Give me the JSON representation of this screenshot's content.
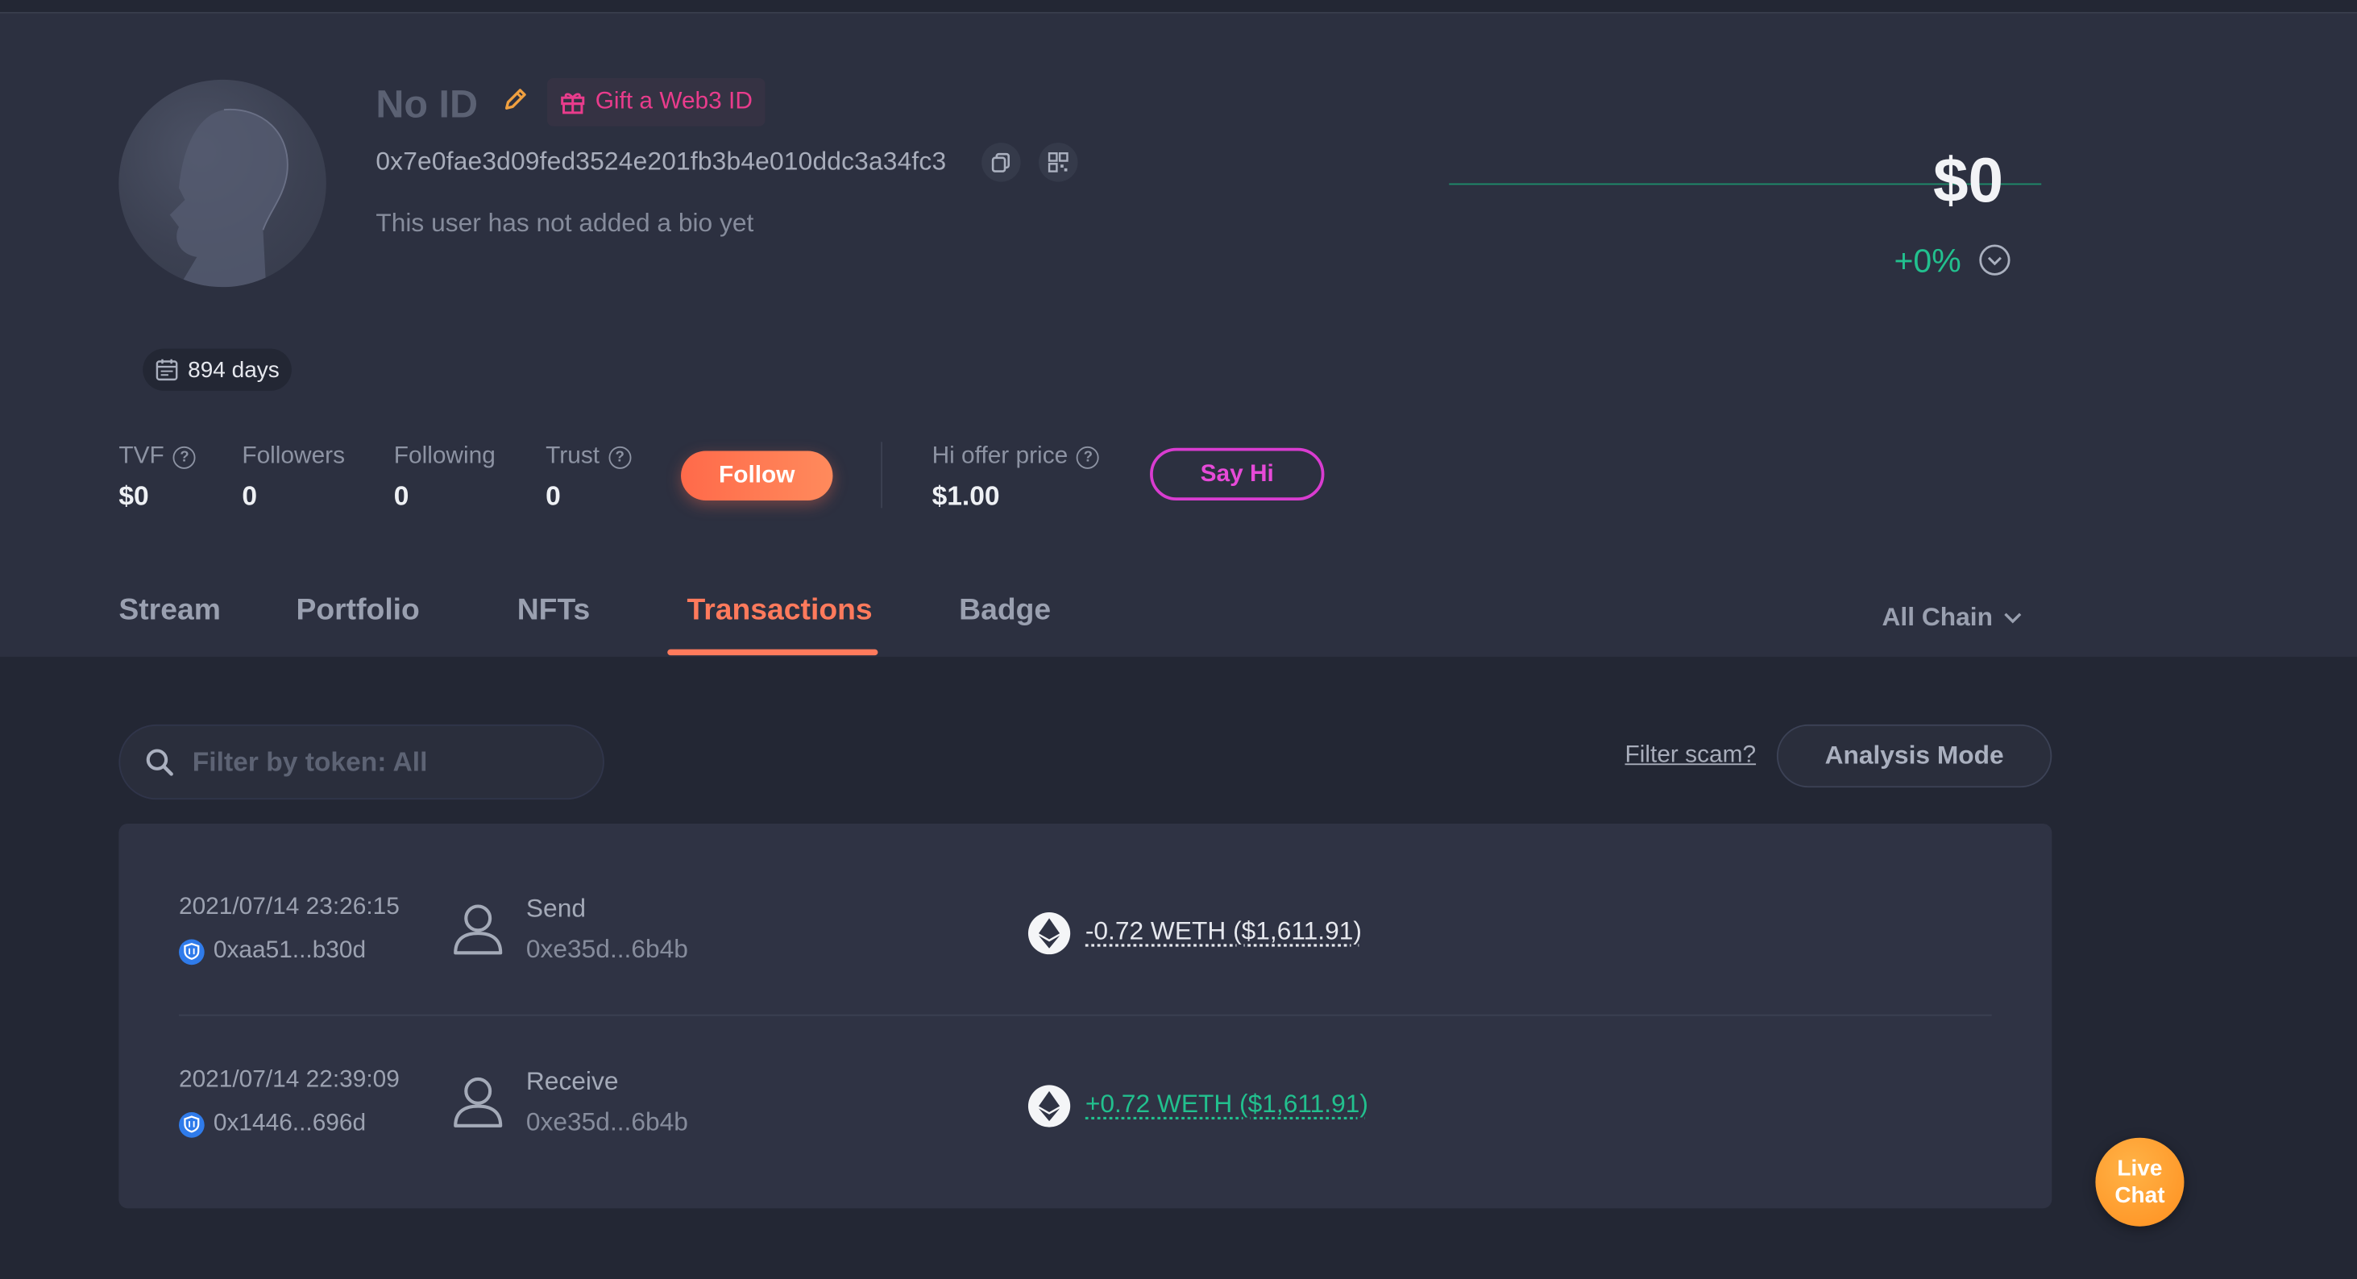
{
  "profile": {
    "name": "No ID",
    "gift_label": "Gift a Web3 ID",
    "address": "0x7e0fae3d09fed3524e201fb3b4e010ddc3a34fc3",
    "bio": "This user has not added a bio yet",
    "days": "894 days"
  },
  "net_worth": {
    "value": "$0",
    "change": "+0%"
  },
  "stats": {
    "tvf": {
      "label": "TVF",
      "value": "$0"
    },
    "followers": {
      "label": "Followers",
      "value": "0"
    },
    "following": {
      "label": "Following",
      "value": "0"
    },
    "trust": {
      "label": "Trust",
      "value": "0"
    },
    "follow_label": "Follow",
    "hi_offer": {
      "label": "Hi offer price",
      "value": "$1.00"
    },
    "say_hi_label": "Say Hi"
  },
  "tabs": [
    {
      "label": "Stream"
    },
    {
      "label": "Portfolio"
    },
    {
      "label": "NFTs"
    },
    {
      "label": "Transactions",
      "active": true
    },
    {
      "label": "Badge"
    }
  ],
  "chain_filter": "All Chain",
  "toolbar": {
    "search_placeholder": "Filter by token: All",
    "filter_scam": "Filter scam?",
    "analysis_mode": "Analysis Mode"
  },
  "transactions": [
    {
      "time": "2021/07/14 23:26:15",
      "from": "0xaa51...b30d",
      "type": "Send",
      "counterparty": "0xe35d...6b4b",
      "amount": "-0.72 WETH ($1,611.91)"
    },
    {
      "time": "2021/07/14 22:39:09",
      "from": "0x1446...696d",
      "type": "Receive",
      "counterparty": "0xe35d...6b4b",
      "amount": "+0.72 WETH ($1,611.91)"
    }
  ],
  "live_chat": {
    "line1": "Live",
    "line2": "Chat"
  },
  "colors": {
    "accent": "#ff7a5c",
    "positive": "#22c08e",
    "say_hi": "#e64ad8",
    "gift": "#e93c8c"
  }
}
